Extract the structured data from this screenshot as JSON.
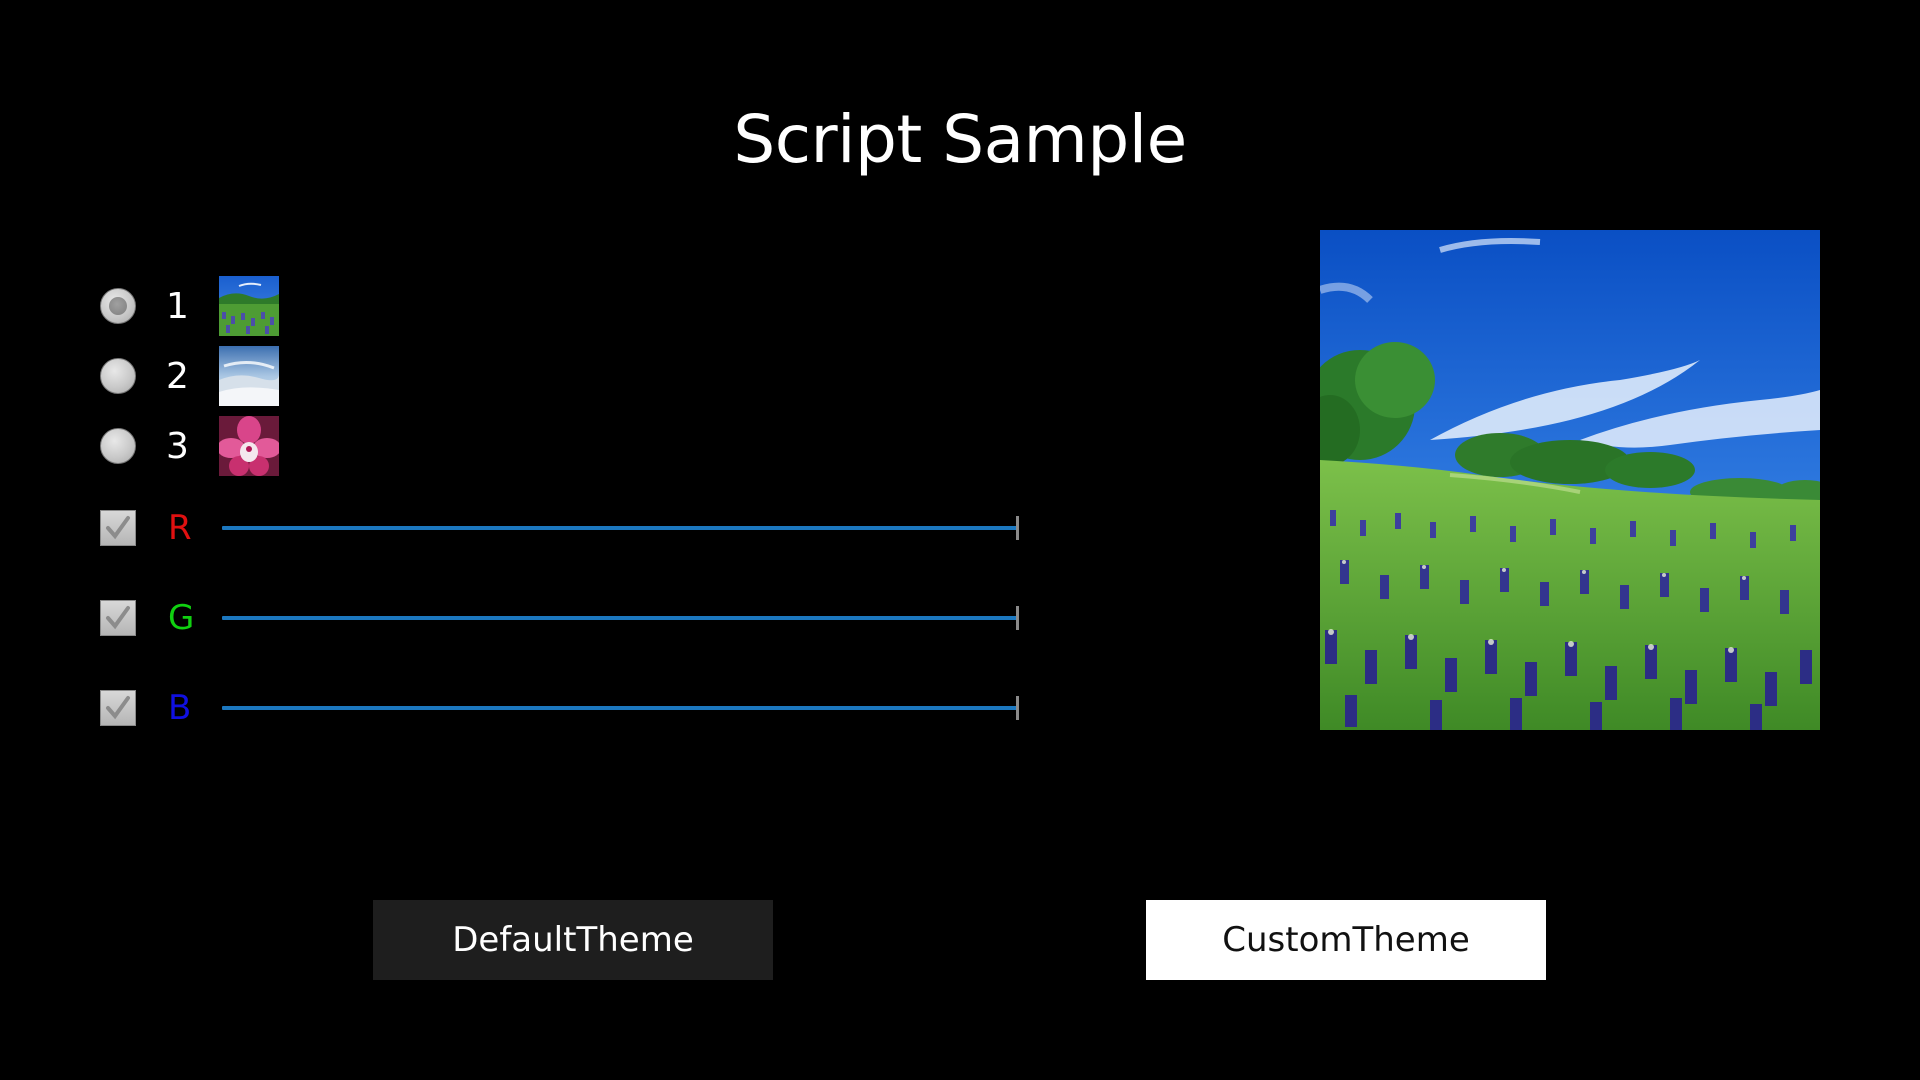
{
  "title": "Script Sample",
  "image_options": [
    {
      "label": "1",
      "thumbnail": "meadow-thumbnail",
      "selected": true
    },
    {
      "label": "2",
      "thumbnail": "sky-thumbnail",
      "selected": false
    },
    {
      "label": "3",
      "thumbnail": "orchid-thumbnail",
      "selected": false
    }
  ],
  "color_channels": [
    {
      "label": "R",
      "color": "#e01010",
      "checked": true,
      "value": 1.0
    },
    {
      "label": "G",
      "color": "#10d010",
      "checked": true,
      "value": 1.0
    },
    {
      "label": "B",
      "color": "#1010e0",
      "checked": true,
      "value": 1.0
    }
  ],
  "preview_image": "meadow-landscape",
  "buttons": {
    "default_theme": "DefaultTheme",
    "custom_theme": "CustomTheme"
  },
  "colors": {
    "background": "#000000",
    "slider_track": "#1c78c0",
    "default_button_bg": "#1e1e1e",
    "custom_button_bg": "#ffffff"
  }
}
